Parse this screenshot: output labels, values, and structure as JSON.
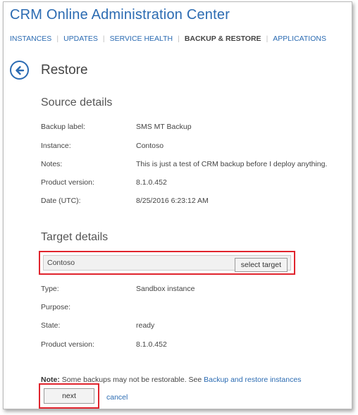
{
  "app": {
    "title": "CRM Online Administration Center"
  },
  "nav": {
    "items": [
      {
        "label": "INSTANCES"
      },
      {
        "label": "UPDATES"
      },
      {
        "label": "SERVICE HEALTH"
      },
      {
        "label": "BACKUP & RESTORE",
        "active": true
      },
      {
        "label": "APPLICATIONS"
      }
    ]
  },
  "page": {
    "title": "Restore"
  },
  "source": {
    "title": "Source details",
    "rows": [
      {
        "label": "Backup label:",
        "value": "SMS MT Backup"
      },
      {
        "label": "Instance:",
        "value": "Contoso"
      },
      {
        "label": "Notes:",
        "value": "This is just a test of CRM backup before I deploy anything."
      },
      {
        "label": "Product version:",
        "value": "8.1.0.452"
      },
      {
        "label": "Date (UTC):",
        "value": "8/25/2016 6:23:12 AM"
      }
    ]
  },
  "target": {
    "title": "Target details",
    "selected": "Contoso",
    "select_label": "select target",
    "rows": [
      {
        "label": "Type:",
        "value": "Sandbox instance"
      },
      {
        "label": "Purpose:",
        "value": ""
      },
      {
        "label": "State:",
        "value": "ready"
      },
      {
        "label": "Product version:",
        "value": "8.1.0.452"
      }
    ]
  },
  "note": {
    "prefix": "Note:",
    "text": " Some backups may not be restorable. See ",
    "link": "Backup and restore instances"
  },
  "actions": {
    "next_label": "next",
    "cancel_label": "cancel"
  },
  "colors": {
    "accent": "#2b6bb2",
    "highlight": "#e0242d"
  }
}
